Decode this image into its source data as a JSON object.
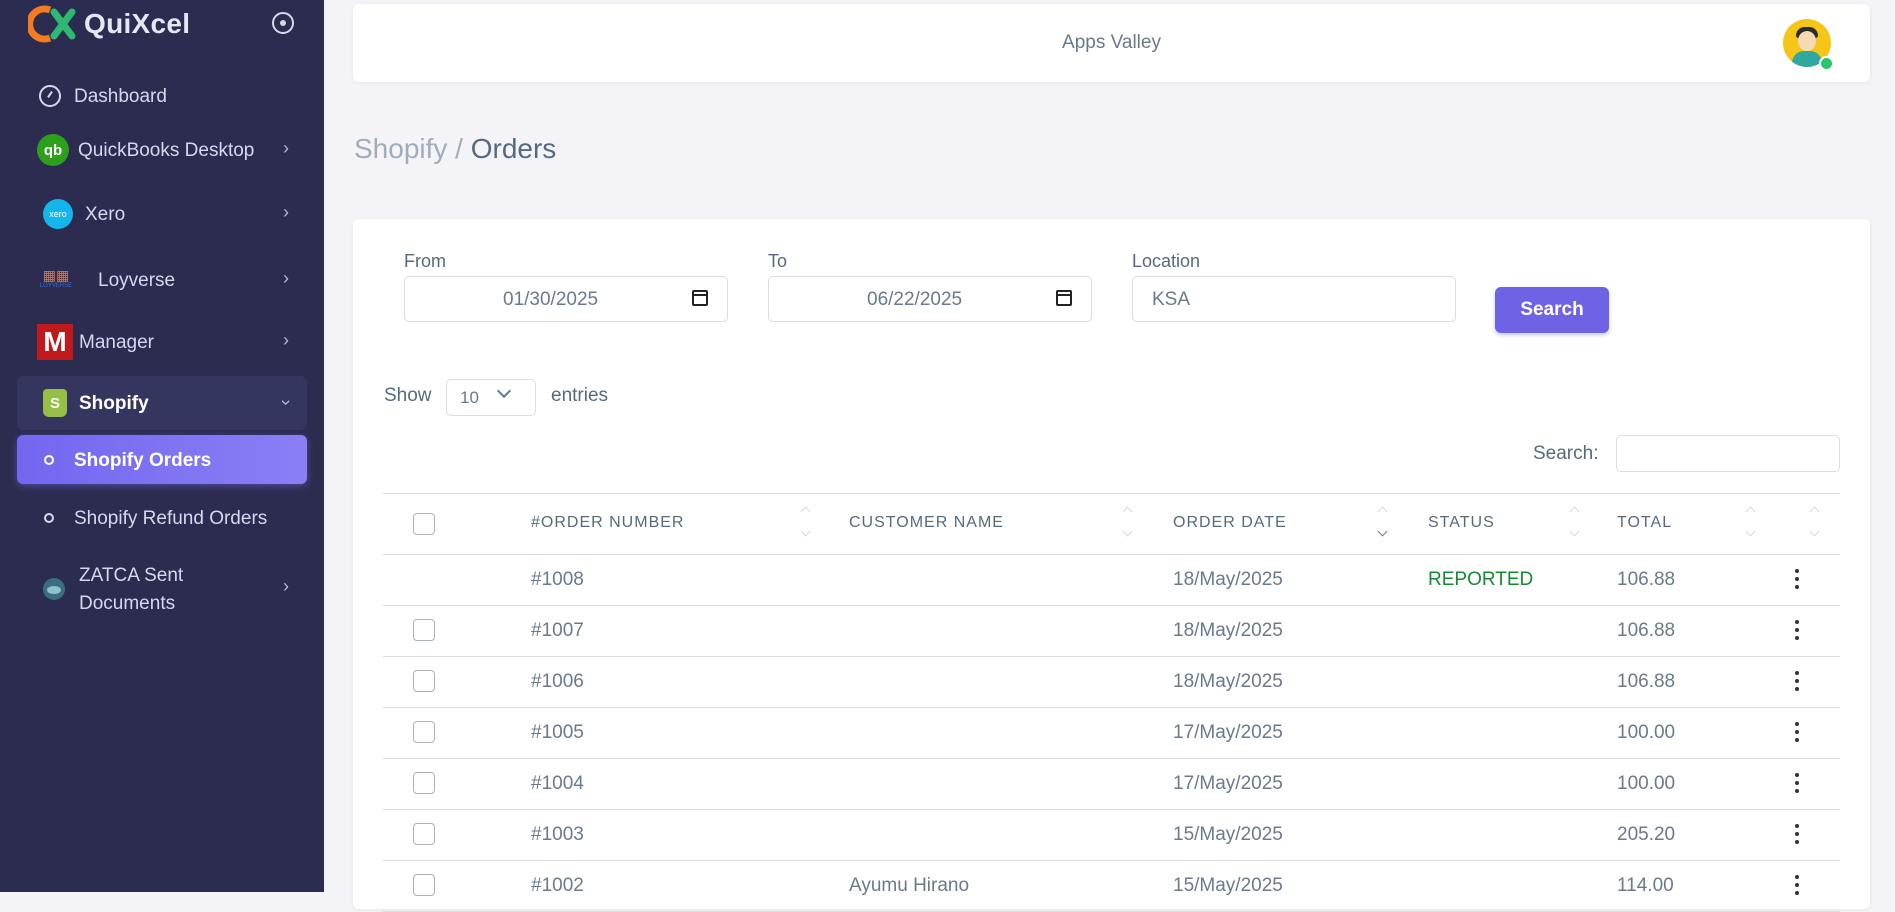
{
  "brand": {
    "name": "QuiXcel"
  },
  "sidebar": {
    "items": [
      {
        "label": "Dashboard"
      },
      {
        "label": "QuickBooks Desktop"
      },
      {
        "label": "Xero"
      },
      {
        "label": "Loyverse"
      },
      {
        "label": "Manager"
      },
      {
        "label": "Shopify"
      },
      {
        "label": "Shopify Orders"
      },
      {
        "label": "Shopify Refund Orders"
      },
      {
        "label": "ZATCA Sent Documents"
      }
    ],
    "icon_glyphs": {
      "qb": "qb",
      "xero": "xero",
      "manager": "M",
      "shopify": "S",
      "loyverse_text": "LOYVERSE"
    }
  },
  "header": {
    "company": "Apps Valley"
  },
  "breadcrumb": {
    "parent": "Shopify /",
    "current": "Orders"
  },
  "filters": {
    "from_label": "From",
    "from_value": "01/30/2025",
    "to_label": "To",
    "to_value": "06/22/2025",
    "location_label": "Location",
    "location_value": "KSA",
    "search_button": "Search"
  },
  "table_controls": {
    "show_label": "Show",
    "page_size": "10",
    "entries_label": "entries",
    "search_label": "Search:"
  },
  "table": {
    "columns": [
      "#ORDER NUMBER",
      "CUSTOMER NAME",
      "ORDER DATE",
      "STATUS",
      "TOTAL"
    ],
    "rows": [
      {
        "order": "#1008",
        "customer": "",
        "date": "18/May/2025",
        "status": "REPORTED",
        "total": "106.88",
        "checkbox": false
      },
      {
        "order": "#1007",
        "customer": "",
        "date": "18/May/2025",
        "status": "",
        "total": "106.88",
        "checkbox": true
      },
      {
        "order": "#1006",
        "customer": "",
        "date": "18/May/2025",
        "status": "",
        "total": "106.88",
        "checkbox": true
      },
      {
        "order": "#1005",
        "customer": "",
        "date": "17/May/2025",
        "status": "",
        "total": "100.00",
        "checkbox": true
      },
      {
        "order": "#1004",
        "customer": "",
        "date": "17/May/2025",
        "status": "",
        "total": "100.00",
        "checkbox": true
      },
      {
        "order": "#1003",
        "customer": "",
        "date": "15/May/2025",
        "status": "",
        "total": "205.20",
        "checkbox": true
      },
      {
        "order": "#1002",
        "customer": "Ayumu Hirano",
        "date": "15/May/2025",
        "status": "",
        "total": "114.00",
        "checkbox": true
      }
    ]
  },
  "colors": {
    "sidebar_bg": "#2b2c4f",
    "accent": "#7367f0",
    "reported": "#168a32"
  }
}
